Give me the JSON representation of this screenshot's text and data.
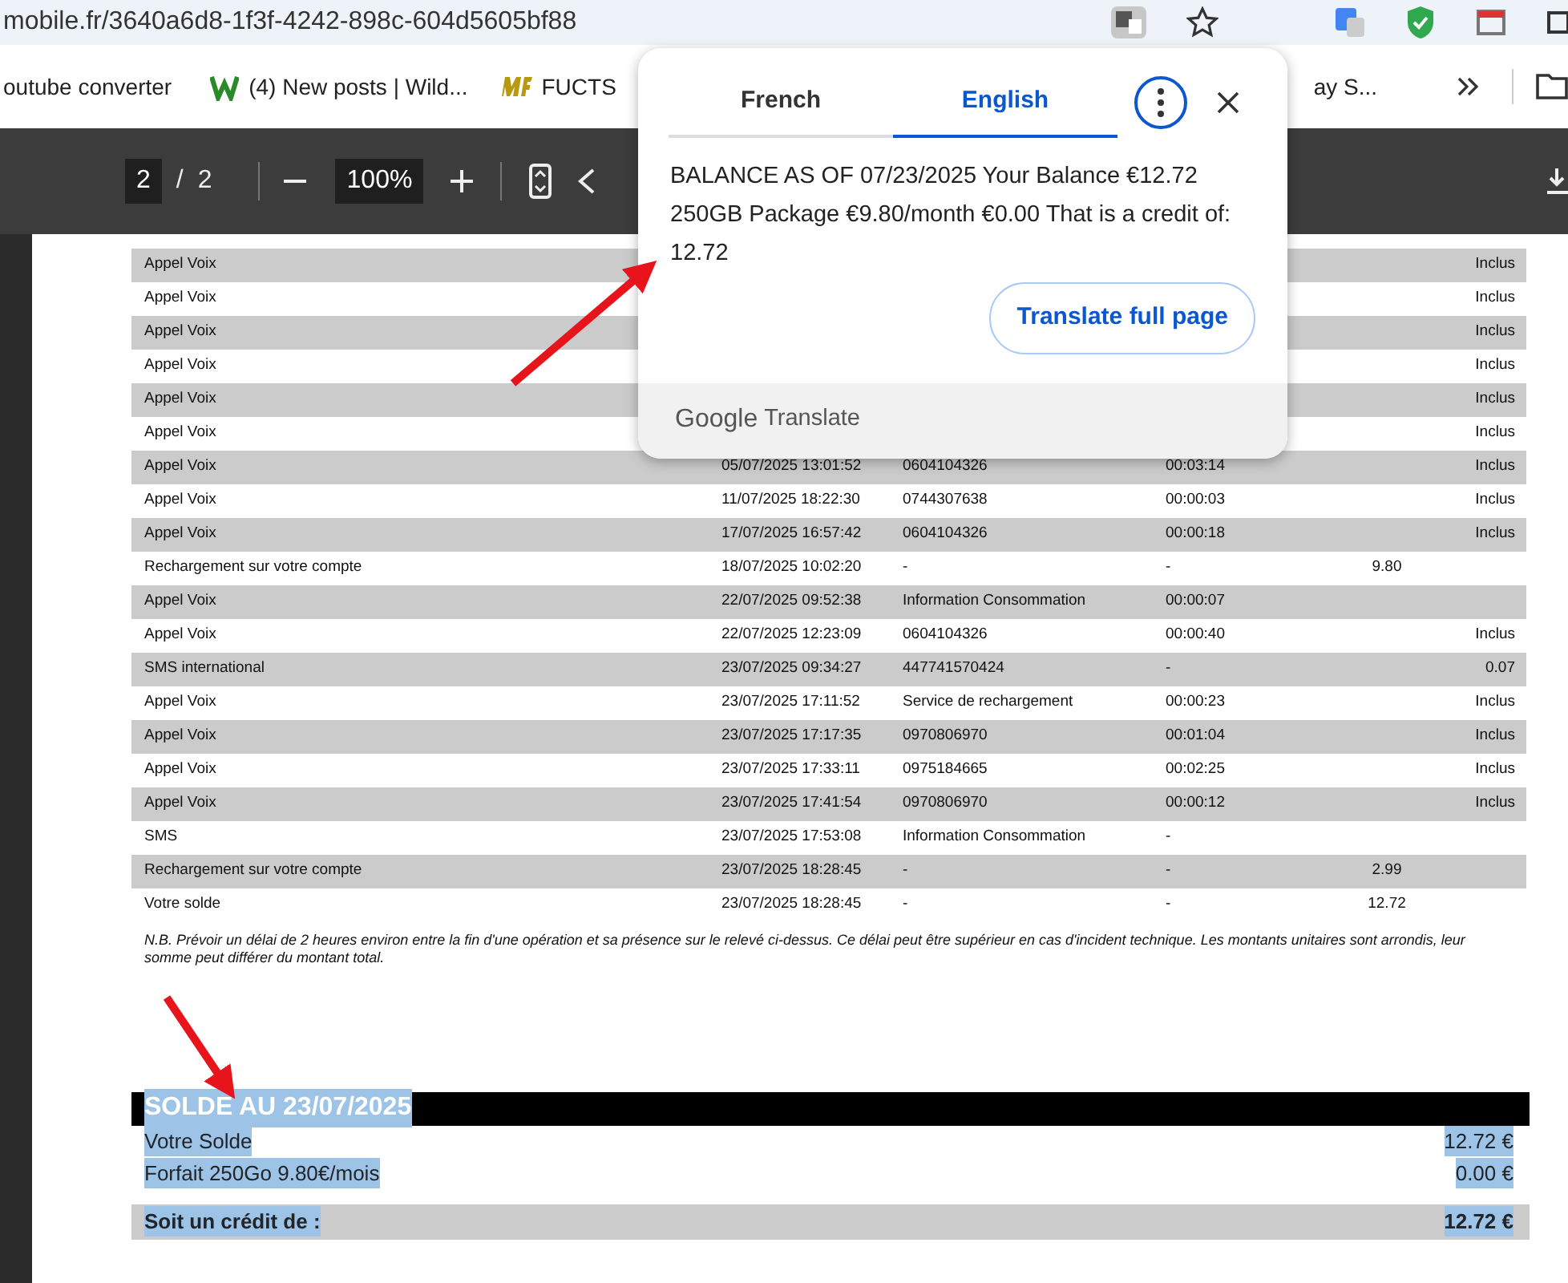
{
  "browser": {
    "url": "mobile.fr/3640a6d8-1f3f-4242-898c-604d5605bf88",
    "bookmarks": [
      {
        "label": "outube converter"
      },
      {
        "label": "(4) New posts | Wild..."
      },
      {
        "label": "FUCTS"
      },
      {
        "label": "ay S..."
      }
    ]
  },
  "pdf_toolbar": {
    "page": "2",
    "separator": "/",
    "total": "2",
    "zoom": "100%"
  },
  "statement": {
    "rows": [
      {
        "type": "Appel Voix",
        "debit": "Inclus"
      },
      {
        "type": "Appel Voix",
        "debit": "Inclus"
      },
      {
        "type": "Appel Voix",
        "debit": "Inclus"
      },
      {
        "type": "Appel Voix",
        "debit": "Inclus"
      },
      {
        "type": "Appel Voix",
        "debit": "Inclus"
      },
      {
        "type": "Appel Voix",
        "debit": "Inclus"
      },
      {
        "type": "Appel Voix",
        "date": "05/07/2025 13:01:52",
        "number": "0604104326",
        "duration": "00:03:14",
        "debit": "Inclus"
      },
      {
        "type": "Appel Voix",
        "date": "11/07/2025 18:22:30",
        "number": "0744307638",
        "duration": "00:00:03",
        "debit": "Inclus"
      },
      {
        "type": "Appel Voix",
        "date": "17/07/2025 16:57:42",
        "number": "0604104326",
        "duration": "00:00:18",
        "debit": "Inclus"
      },
      {
        "type": "Rechargement sur votre compte",
        "date": "18/07/2025 10:02:20",
        "number": "-",
        "duration": "-",
        "credit": "9.80"
      },
      {
        "type": "Appel Voix",
        "date": "22/07/2025 09:52:38",
        "number": "Information Consommation",
        "duration": "00:00:07"
      },
      {
        "type": "Appel Voix",
        "date": "22/07/2025 12:23:09",
        "number": "0604104326",
        "duration": "00:00:40",
        "debit": "Inclus"
      },
      {
        "type": "SMS international",
        "date": "23/07/2025 09:34:27",
        "number": "447741570424",
        "duration": "-",
        "debit": "0.07"
      },
      {
        "type": "Appel Voix",
        "date": "23/07/2025 17:11:52",
        "number": "Service de rechargement",
        "duration": "00:00:23",
        "debit": "Inclus"
      },
      {
        "type": "Appel Voix",
        "date": "23/07/2025 17:17:35",
        "number": "0970806970",
        "duration": "00:01:04",
        "debit": "Inclus"
      },
      {
        "type": "Appel Voix",
        "date": "23/07/2025 17:33:11",
        "number": "0975184665",
        "duration": "00:02:25",
        "debit": "Inclus"
      },
      {
        "type": "Appel Voix",
        "date": "23/07/2025 17:41:54",
        "number": "0970806970",
        "duration": "00:00:12",
        "debit": "Inclus"
      },
      {
        "type": "SMS",
        "date": "23/07/2025 17:53:08",
        "number": "Information Consommation",
        "duration": "-"
      },
      {
        "type": "Rechargement sur votre compte",
        "date": "23/07/2025 18:28:45",
        "number": "-",
        "duration": "-",
        "credit": "2.99"
      },
      {
        "type": "Votre solde",
        "date": "23/07/2025 18:28:45",
        "number": "-",
        "duration": "-",
        "credit": "12.72"
      }
    ],
    "note": "N.B. Prévoir un délai de 2 heures environ entre la fin d'une opération et sa présence sur le relevé ci-dessus. Ce délai peut être supérieur en cas d'incident technique. Les montants unitaires sont arrondis, leur somme peut différer du montant total."
  },
  "summary": {
    "title": "SOLDE AU 23/07/2025",
    "highlighted": true,
    "lines": [
      {
        "label": "Votre Solde",
        "amount": "12.72 €",
        "kind": "plain"
      },
      {
        "label": "Forfait 250Go 9.80€/mois",
        "amount": "0.00 €",
        "kind": "plain"
      },
      {
        "label": "Soit un crédit de :",
        "amount": "12.72 €",
        "kind": "total"
      }
    ]
  },
  "translate_popup": {
    "tabs": [
      {
        "label": "French",
        "selected": false
      },
      {
        "label": "English",
        "selected": true
      }
    ],
    "text": "BALANCE AS OF 07/23/2025 Your Balance €12.72 250GB Package €9.80/month €0.00 That is a credit of: 12.72",
    "button": "Translate full page",
    "footer_brand": "Google",
    "footer_product": "Translate"
  }
}
